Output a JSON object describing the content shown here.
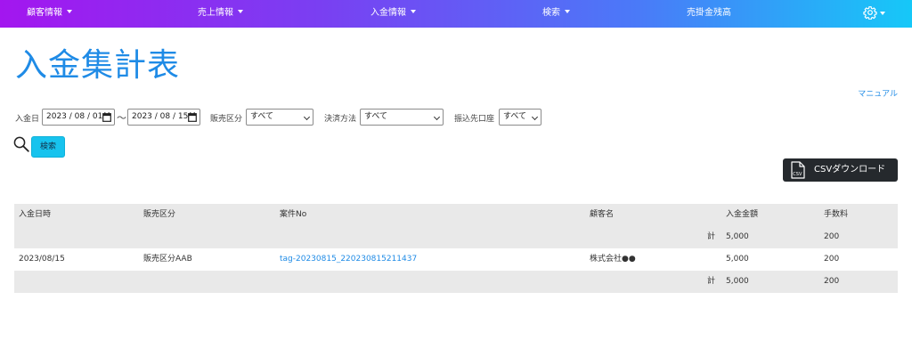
{
  "nav": {
    "items": [
      {
        "label": "顧客情報",
        "has_caret": true
      },
      {
        "label": "売上情報",
        "has_caret": true
      },
      {
        "label": "入金情報",
        "has_caret": true
      },
      {
        "label": "検索",
        "has_caret": true
      },
      {
        "label": "売掛金残高",
        "has_caret": false
      }
    ],
    "settings_icon": "gear-icon"
  },
  "page": {
    "title": "入金集計表",
    "manual_link": "マニュアル"
  },
  "filters": {
    "date_label": "入金日",
    "date_from": "2023 / 08 / 01",
    "tilde": "～",
    "date_to": "2023 / 08 / 15",
    "sales_category_label": "販売区分",
    "sales_category_value": "すべて",
    "payment_method_label": "決済方法",
    "payment_method_value": "すべて",
    "transfer_account_label": "振込先口座",
    "transfer_account_value": "すべて"
  },
  "search": {
    "icon": "search-icon",
    "button_label": "検索"
  },
  "csv": {
    "icon": "csv-file-icon",
    "icon_text": "CSV",
    "button_label": "CSVダウンロード"
  },
  "table": {
    "headers": [
      "入金日時",
      "販売区分",
      "案件No",
      "顧客名",
      "入金金額",
      "手数料"
    ],
    "summary_top": {
      "kei": "計",
      "amount": "5,000",
      "fee": "200"
    },
    "rows": [
      {
        "datetime": "2023/08/15",
        "category": "販売区分AAB",
        "case_no": "tag-20230815_220230815211437",
        "customer": "株式会社●●",
        "amount": "5,000",
        "fee": "200"
      }
    ],
    "summary_bottom": {
      "kei": "計",
      "amount": "5,000",
      "fee": "200"
    }
  },
  "colors": {
    "nav_gradient_start": "#a316ef",
    "nav_gradient_end": "#16c8f8",
    "title": "#1f8be6",
    "search_button": "#17c3ee",
    "csv_button": "#25292d",
    "row_shade": "#e9e9e9"
  }
}
